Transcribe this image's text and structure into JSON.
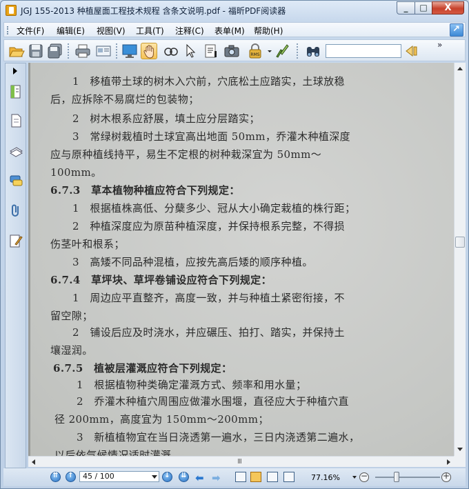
{
  "window": {
    "title": "JGJ 155-2013 种植屋面工程技术规程 含条文说明.pdf - 福昕PDF阅读器",
    "controls": {
      "minimize": "_",
      "maximize": "□",
      "close": "X"
    }
  },
  "menu": {
    "items": [
      {
        "label": "文件(F)"
      },
      {
        "label": "编辑(E)"
      },
      {
        "label": "视图(V)"
      },
      {
        "label": "工具(T)"
      },
      {
        "label": "注释(C)"
      },
      {
        "label": "表单(M)"
      },
      {
        "label": "帮助(H)"
      }
    ]
  },
  "toolbar": {
    "icons": [
      "open-folder-icon",
      "save-icon",
      "save-all-icon",
      "print-icon",
      "email-icon",
      "fullscreen-icon",
      "hand-icon",
      "select-text-icon",
      "arrow-select-icon",
      "typewriter-icon",
      "snapshot-icon",
      "rms-lock-icon",
      "sign-icon",
      "binoculars-icon"
    ],
    "rms_label": "RMS",
    "search_value": "",
    "more": "»"
  },
  "document": {
    "lines": [
      "1　移植带土球的树木入穴前，穴底松土应踏实，土球放稳",
      "后，应拆除不易腐烂的包装物；",
      "2　树木根系应舒展，填土应分层踏实；",
      "3　常绿树栽植时土球宜高出地面 50mm，乔灌木种植深度",
      "应与原种植线持平，易生不定根的树种栽深宜为 50mm～",
      "100mm。",
      "6.7.3　草本植物种植应符合下列规定：",
      "1　根据植株高低、分蘖多少、冠从大小确定栽植的株行距；",
      "2　种植深度应为原苗种植深度，并保持根系完整，不得损",
      "伤茎叶和根系；",
      "3　高矮不同品种混植，应按先高后矮的顺序种植。",
      "6.7.4　草坪块、草坪卷铺设应符合下列规定：",
      "1　周边应平直整齐，高度一致，并与种植土紧密衔接，不",
      "留空隙；",
      "2　铺设后应及时浇水，并应碾压、拍打、踏实，并保持土",
      "壤湿润。",
      "6.7.5　植被层灌溉应符合下列规定：",
      "1　根据植物种类确定灌溉方式、频率和用水量；",
      "2　乔灌木种植穴周围应做灌水围堰，直径应大于种植穴直",
      "径 200mm，高度宜为 150mm～200mm；",
      "3　新植植物宜在当日浇透第一遍水，三日内浇透第二遍水，",
      "以后依气候情况适时灌溉。"
    ]
  },
  "scroll": {
    "h_grip": "III"
  },
  "status": {
    "page_value": "45 / 100",
    "page_current": 45,
    "page_total": 100,
    "zoom": "77.16%",
    "zoom_minus": "−",
    "zoom_plus": "+",
    "zoom_slider_fraction": 0.35
  },
  "colors": {
    "title_bar": "#c7d8ec",
    "close_button": "#c7412b",
    "accent_blue": "#2b73c4",
    "page_scan": "#c9cbc9"
  }
}
